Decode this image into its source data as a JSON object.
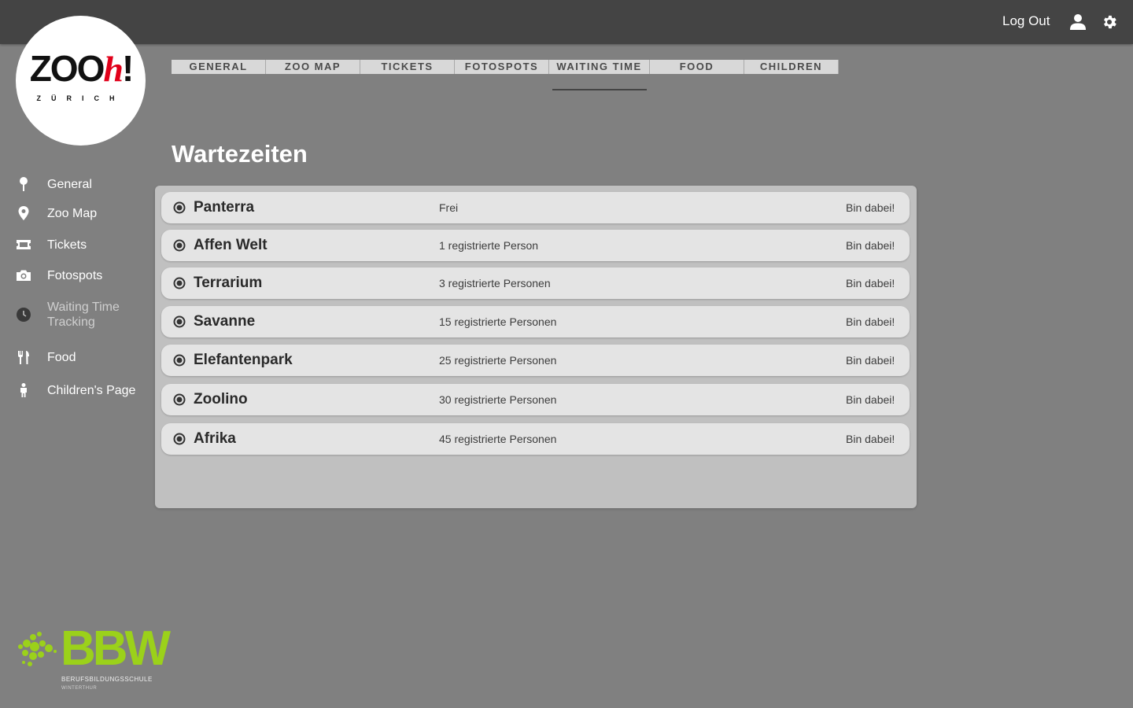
{
  "header": {
    "logout_label": "Log Out",
    "icons": [
      "user-icon",
      "gear-icon"
    ],
    "background": "#444444"
  },
  "logo": {
    "word_main": "ZOO",
    "word_h": "h",
    "word_bang": "!",
    "sub": "ZÜRICH"
  },
  "sidebar": {
    "items": [
      {
        "label": "General",
        "icon": "pin-icon"
      },
      {
        "label": "Zoo Map",
        "icon": "map-marker-icon"
      },
      {
        "label": "Tickets",
        "icon": "ticket-icon"
      },
      {
        "label": "Fotospots",
        "icon": "camera-icon"
      },
      {
        "label": "Waiting Time Tracking",
        "icon": "clock-icon"
      },
      {
        "label": "Food",
        "icon": "cutlery-icon"
      },
      {
        "label": "Children's Page",
        "icon": "child-icon"
      }
    ]
  },
  "tabs": {
    "items": [
      "GENERAL",
      "ZOO MAP",
      "TICKETS",
      "FOTOSPOTS",
      "WAITING TIME",
      "FOOD",
      "CHILDREN"
    ],
    "active": "WAITING TIME"
  },
  "main": {
    "title": "Wartezeiten",
    "rows": [
      {
        "name": "Panterra",
        "status": "Frei",
        "action": "Bin dabei!"
      },
      {
        "name": "Affen Welt",
        "status": "1 registrierte Person",
        "action": "Bin dabei!"
      },
      {
        "name": "Terrarium",
        "status": "3 registrierte Personen",
        "action": "Bin dabei!"
      },
      {
        "name": "Savanne",
        "status": "15 registrierte Personen",
        "action": "Bin dabei!"
      },
      {
        "name": "Elefantenpark",
        "status": "25 registrierte Personen",
        "action": "Bin dabei!"
      },
      {
        "name": "Zoolino",
        "status": "30 registrierte Personen",
        "action": "Bin dabei!"
      },
      {
        "name": "Afrika",
        "status": "45 registrierte Personen",
        "action": "Bin dabei!"
      }
    ]
  },
  "footer_logo": {
    "word": "BBW",
    "line1": "BERUFSBILDUNGSSCHULE",
    "line2": "WINTERTHUR",
    "color": "#9bd11a"
  }
}
